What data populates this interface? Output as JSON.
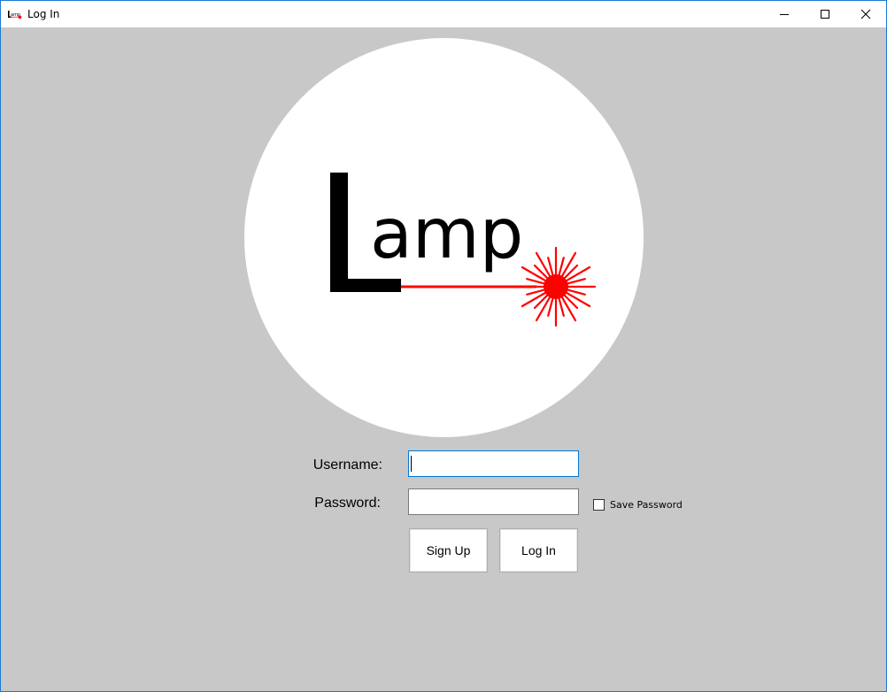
{
  "window": {
    "title": "Log In",
    "app_icon": "lamp-app-icon"
  },
  "logo": {
    "wordmark": "Lamp",
    "laser_color": "#ff0000"
  },
  "form": {
    "username_label": "Username:",
    "username_value": "",
    "password_label": "Password:",
    "password_value": "",
    "save_password_label": "Save Password",
    "save_password_checked": false
  },
  "buttons": {
    "signup_label": "Sign Up",
    "login_label": "Log In"
  },
  "colors": {
    "background": "#c8c8c8",
    "focus_border": "#0078d7",
    "window_border": "#1a7ad4"
  }
}
